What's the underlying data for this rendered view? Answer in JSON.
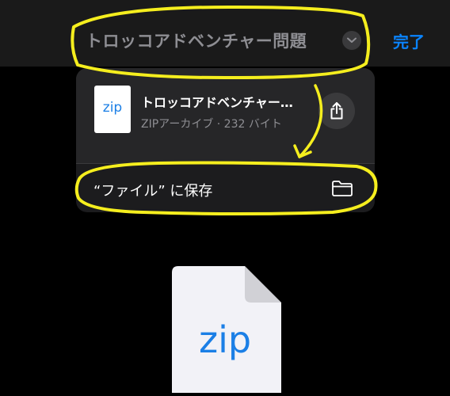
{
  "navbar": {
    "title": "トロッコアドベンチャー問題",
    "done_label": "完了"
  },
  "popover": {
    "file_type_badge": "zip",
    "file_name": "トロッコアドベンチャー問題",
    "file_meta": "ZIPアーカイブ · 232 バイト",
    "save_label": "“ファイル” に保存"
  },
  "preview": {
    "file_type_label": "zip"
  },
  "icons": {
    "chevron": "chevron-down-icon",
    "share": "share-icon",
    "folder": "folder-icon"
  },
  "colors": {
    "accent": "#0a84ff",
    "zip_blue": "#1b7fe6",
    "annotation": "#f5ee1e"
  }
}
